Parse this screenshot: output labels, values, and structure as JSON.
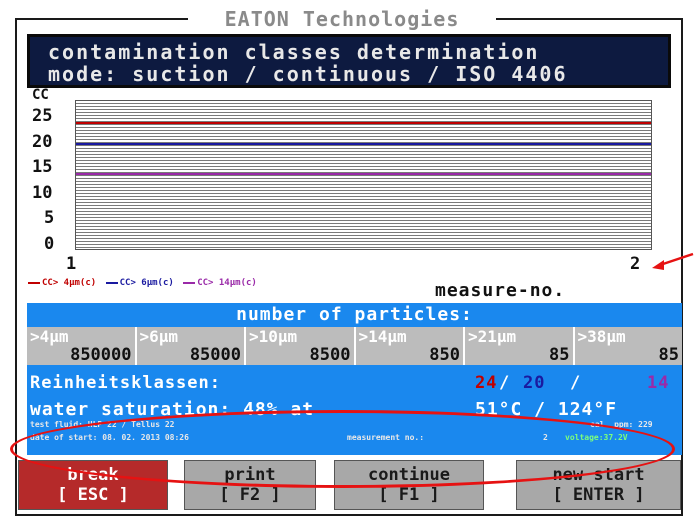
{
  "brand": "EATON Technologies",
  "title_line1": "contamination classes determination",
  "title_line2": "mode: suction / continuous / ISO 4406",
  "colors": {
    "title_bg": "#0d1a40",
    "panel_blue": "#1a88ee",
    "series_4um": "#c00000",
    "series_6um": "#1a1aa0",
    "series_14um": "#9a2aa8",
    "annotation_red": "#e61212"
  },
  "chart_data": {
    "type": "line",
    "ylabel": "CC",
    "xlabel": "measure-no.",
    "ylim": [
      0,
      25
    ],
    "yticks": [
      "25",
      "20",
      "15",
      "10",
      "5",
      "0"
    ],
    "xticks": [
      "1",
      "2"
    ],
    "x": [
      1,
      2
    ],
    "series": [
      {
        "name": "CC> 4µm(c)",
        "values": [
          24,
          24
        ]
      },
      {
        "name": "CC> 6µm(c)",
        "values": [
          20,
          20
        ]
      },
      {
        "name": "CC> 14µm(c)",
        "values": [
          14,
          14
        ]
      }
    ]
  },
  "particles": {
    "title": "number of particles:",
    "columns": [
      {
        "header": ">4µm",
        "value": "850000"
      },
      {
        "header": ">6µm",
        "value": "85000"
      },
      {
        "header": ">10µm",
        "value": "8500"
      },
      {
        "header": ">14µm",
        "value": "850"
      },
      {
        "header": ">21µm",
        "value": "85"
      },
      {
        "header": ">38µm",
        "value": "85"
      }
    ]
  },
  "reinheit": {
    "label": "Reinheitsklassen:",
    "v4": "24",
    "sep1": "/",
    "v6": "20",
    "sep2": "/",
    "v14": "14"
  },
  "water": {
    "text": "water saturation: 48% at",
    "temp": "51°C / 124°F"
  },
  "info": {
    "fluid": "test fluid: HLP 22 / Tellus 22",
    "cal": "cal. ppm: 229",
    "date": "date of start: 08. 02. 2013  08:26",
    "measurement": "measurement no.:",
    "measurement_value": "2",
    "voltage": "voltage:37.2V"
  },
  "buttons": [
    {
      "line1": "break",
      "line2": "[ ESC ]"
    },
    {
      "line1": "print",
      "line2": "[ F2 ]"
    },
    {
      "line1": "continue",
      "line2": "[ F1 ]"
    },
    {
      "line1": "new start",
      "line2": "[ ENTER ]"
    }
  ]
}
